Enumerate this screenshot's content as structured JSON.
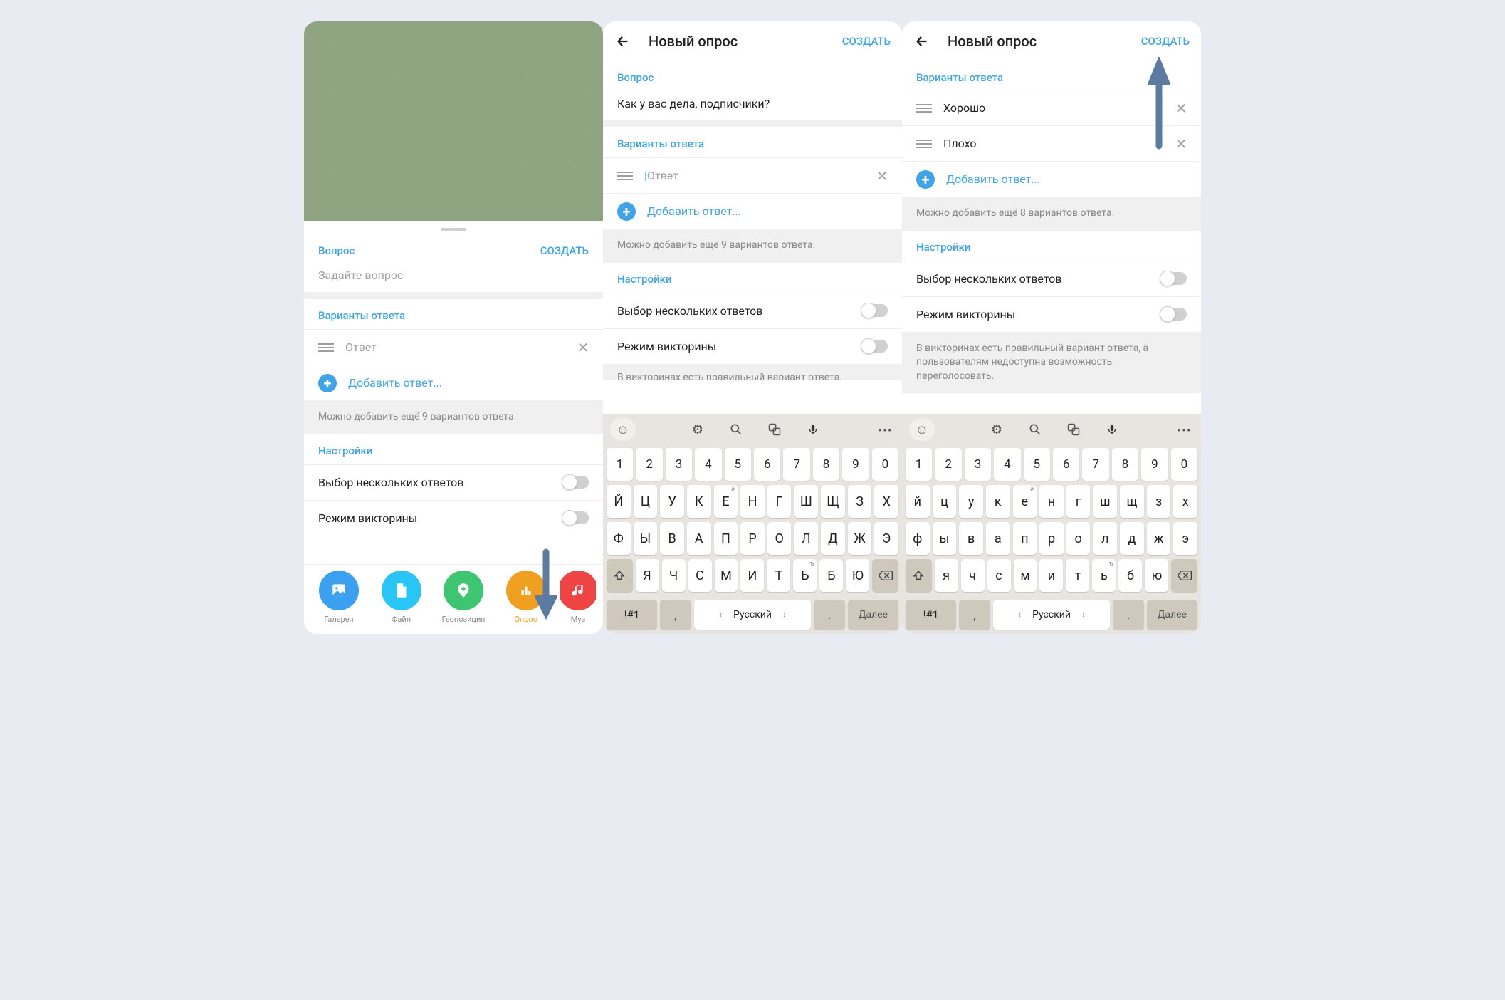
{
  "common": {
    "title": "Новый опрос",
    "create": "СОЗДАТЬ",
    "question_label": "Вопрос",
    "answers_label": "Варианты ответа",
    "answer_placeholder": "Ответ",
    "question_placeholder": "Задайте вопрос",
    "add_answer": "Добавить ответ...",
    "settings_label": "Настройки",
    "multi_choice": "Выбор нескольких ответов",
    "quiz_mode": "Режим викторины",
    "quiz_hint": "В викторинах есть правильный вариант ответа, а пользователям недоступна возможность переголосовать."
  },
  "s1": {
    "hint": "Можно добавить ещё 9 вариантов ответа.",
    "attach": [
      {
        "label": "Галерея",
        "color": "#3ba0ef"
      },
      {
        "label": "Файл",
        "color": "#29c5f6"
      },
      {
        "label": "Геопозиция",
        "color": "#3ec56f"
      },
      {
        "label": "Опрос",
        "color": "#f0a020",
        "active": true
      },
      {
        "label": "Муз",
        "color": "#ef4444"
      }
    ]
  },
  "s2": {
    "question_value": "Как у вас дела, подписчики?",
    "hint": "Можно добавить ещё 9 вариантов ответа.",
    "quiz_hint_truncated": "В викторинах есть правильный вариант ответа,"
  },
  "s3": {
    "answers": [
      "Хорошо",
      "Плохо"
    ],
    "hint": "Можно добавить ещё 8 вариантов ответа."
  },
  "kbd": {
    "nums": [
      "1",
      "2",
      "3",
      "4",
      "5",
      "6",
      "7",
      "8",
      "9",
      "0"
    ],
    "r1_upper": [
      "Й",
      "Ц",
      "У",
      "К",
      "Е",
      "Н",
      "Г",
      "Ш",
      "Щ",
      "З",
      "Х"
    ],
    "r1_lower": [
      "й",
      "ц",
      "у",
      "к",
      "е",
      "н",
      "г",
      "ш",
      "щ",
      "з",
      "х"
    ],
    "r2_upper": [
      "Ф",
      "Ы",
      "В",
      "А",
      "П",
      "Р",
      "О",
      "Л",
      "Д",
      "Ж",
      "Э"
    ],
    "r2_lower": [
      "ф",
      "ы",
      "в",
      "а",
      "п",
      "р",
      "о",
      "л",
      "д",
      "ж",
      "э"
    ],
    "r3_upper": [
      "Я",
      "Ч",
      "С",
      "М",
      "И",
      "Т",
      "Ь",
      "Б",
      "Ю"
    ],
    "r3_lower": [
      "я",
      "ч",
      "с",
      "м",
      "и",
      "т",
      "ь",
      "б",
      "ю"
    ],
    "sup_e": "ё",
    "sup_hard": "ъ",
    "sym": "!#1",
    "lang": "Русский",
    "enter": "Далее",
    "dot": ".",
    "comma": ","
  }
}
